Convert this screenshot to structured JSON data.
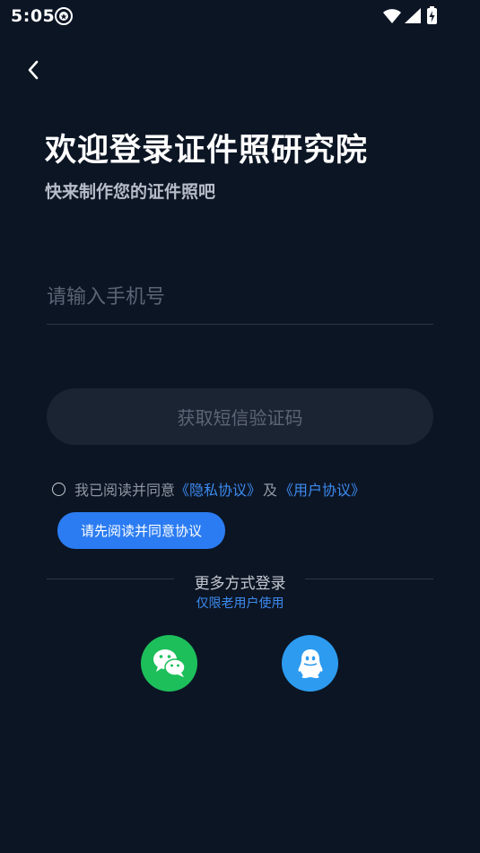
{
  "status_bar": {
    "time": "5:05"
  },
  "page": {
    "title": "欢迎登录证件照研究院",
    "subtitle": "快来制作您的证件照吧"
  },
  "phone_input": {
    "placeholder": "请输入手机号",
    "value": ""
  },
  "code_button": {
    "label": "获取短信验证码"
  },
  "agreement": {
    "checked": false,
    "prefix": "我已阅读并同意",
    "privacy_link": "《隐私协议》",
    "and": "及",
    "user_link": "《用户协议》",
    "tooltip": "请先阅读并同意协议"
  },
  "other_login": {
    "title": "更多方式登录",
    "note": "仅限老用户使用",
    "options": [
      "wechat-icon",
      "qq-icon"
    ]
  },
  "colors": {
    "background": "#0c1524",
    "accent": "#2b7cf2",
    "wechat": "#1dbf5b",
    "qq": "#2c9bf0"
  }
}
